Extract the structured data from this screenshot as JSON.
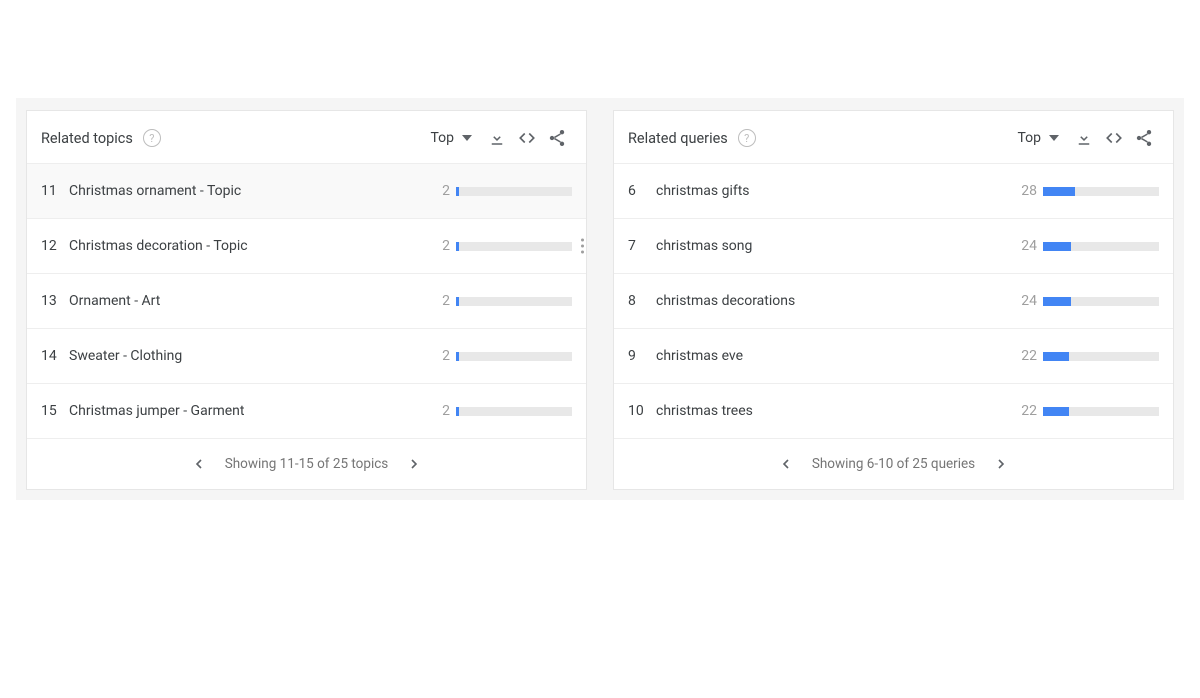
{
  "panels": [
    {
      "title": "Related topics",
      "sort": "Top",
      "rows": [
        {
          "rank": "11",
          "label": "Christmas ornament - Topic",
          "value": "2",
          "pct": 3,
          "highlight": true,
          "more": false
        },
        {
          "rank": "12",
          "label": "Christmas decoration - Topic",
          "value": "2",
          "pct": 3,
          "highlight": false,
          "more": true
        },
        {
          "rank": "13",
          "label": "Ornament - Art",
          "value": "2",
          "pct": 3,
          "highlight": false,
          "more": false
        },
        {
          "rank": "14",
          "label": "Sweater - Clothing",
          "value": "2",
          "pct": 3,
          "highlight": false,
          "more": false
        },
        {
          "rank": "15",
          "label": "Christmas jumper - Garment",
          "value": "2",
          "pct": 3,
          "highlight": false,
          "more": false
        }
      ],
      "pager": "Showing 11-15 of 25 topics"
    },
    {
      "title": "Related queries",
      "sort": "Top",
      "rows": [
        {
          "rank": "6",
          "label": "christmas gifts",
          "value": "28",
          "pct": 28,
          "highlight": false,
          "more": false
        },
        {
          "rank": "7",
          "label": "christmas song",
          "value": "24",
          "pct": 24,
          "highlight": false,
          "more": false
        },
        {
          "rank": "8",
          "label": "christmas decorations",
          "value": "24",
          "pct": 24,
          "highlight": false,
          "more": false
        },
        {
          "rank": "9",
          "label": "christmas eve",
          "value": "22",
          "pct": 22,
          "highlight": false,
          "more": false
        },
        {
          "rank": "10",
          "label": "christmas trees",
          "value": "22",
          "pct": 22,
          "highlight": false,
          "more": false
        }
      ],
      "pager": "Showing 6-10 of 25 queries"
    }
  ]
}
